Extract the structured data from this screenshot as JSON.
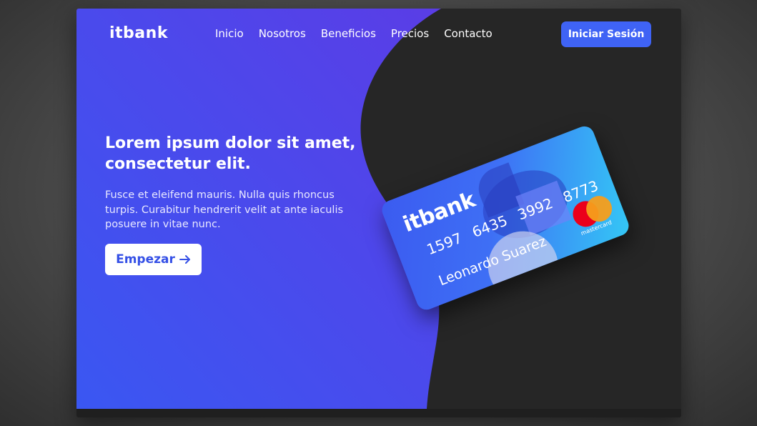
{
  "brand": "itbank",
  "nav": {
    "items": [
      "Inicio",
      "Nosotros",
      "Beneficios",
      "Precios",
      "Contacto"
    ]
  },
  "header": {
    "login_label": "Iniciar Sesión"
  },
  "hero": {
    "title": "Lorem ipsum dolor sit amet, consectetur elit.",
    "subtitle": "Fusce et eleifend mauris. Nulla quis rhoncus turpis. Curabitur hendrerit velit at ante iaculis posuere in vitae nunc.",
    "cta_label": "Empezar",
    "cta_icon": "arrow-right-icon"
  },
  "card": {
    "brand": "itbank",
    "number_groups": [
      "1597",
      "6435",
      "3992",
      "8773"
    ],
    "holder": "Leonardo Suarez",
    "network": "mastercard"
  },
  "colors": {
    "hero_gradient_start": "#3a57f2",
    "hero_gradient_end": "#5a3de6",
    "dark_background": "#262626",
    "button_primary": "#3f63f5",
    "cta_text": "#3550e6"
  }
}
